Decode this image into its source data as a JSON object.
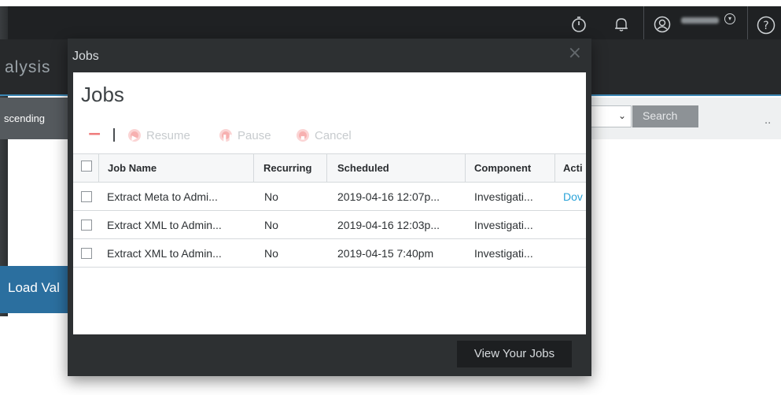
{
  "app": {
    "title_fragment": "alysis",
    "sort_label_fragment": "scending",
    "search_button": "Search",
    "overflow": "..",
    "load_button_fragment": "Load Val"
  },
  "topbar": {
    "icons": [
      "stopwatch-icon",
      "bell-icon",
      "user-icon",
      "help-icon"
    ],
    "help_glyph": "?"
  },
  "dialog": {
    "title": "Jobs",
    "close": "×",
    "heading": "Jobs",
    "toolbar": {
      "remove": "−",
      "resume": "Resume",
      "pause": "Pause",
      "cancel": "Cancel"
    },
    "columns": [
      "Job Name",
      "Recurring",
      "Scheduled",
      "Component",
      "Acti"
    ],
    "rows": [
      {
        "name": "Extract Meta to Admi...",
        "recurring": "No",
        "scheduled": "2019-04-16 12:07p...",
        "component": "Investigati...",
        "action": "Dov"
      },
      {
        "name": "Extract XML to Admin...",
        "recurring": "No",
        "scheduled": "2019-04-16 12:03p...",
        "component": "Investigati...",
        "action": ""
      },
      {
        "name": "Extract XML to Admin...",
        "recurring": "No",
        "scheduled": "2019-04-15 7:40pm",
        "component": "Investigati...",
        "action": ""
      }
    ],
    "footer_button": "View Your Jobs"
  },
  "colors": {
    "accent": "#2aa3d8",
    "toolbar_disabled": "#ef7c7c",
    "dialog_bg": "#2d3032"
  }
}
